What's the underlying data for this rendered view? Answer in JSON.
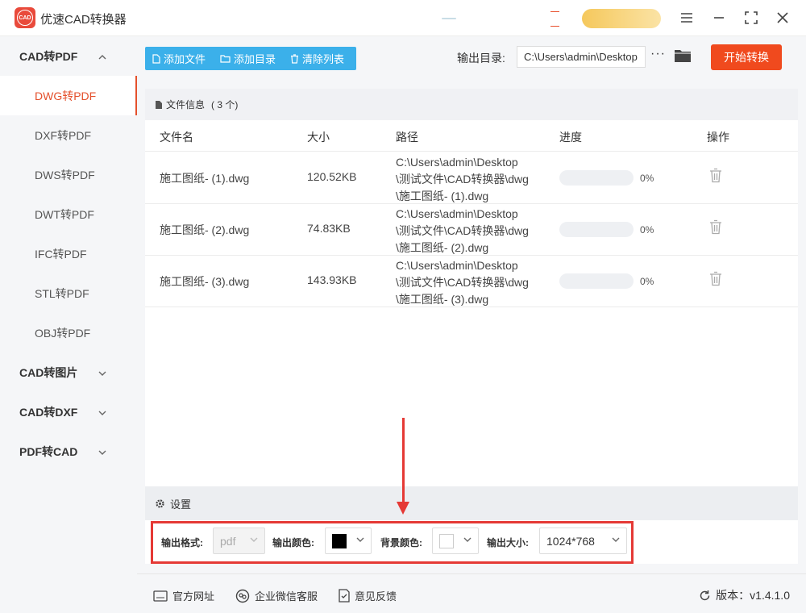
{
  "app": {
    "logo_text": "CAD",
    "title": "优速CAD转换器"
  },
  "window_controls": {
    "menu": "≡",
    "minimize": "—",
    "maximize": "⤢",
    "close": "✕"
  },
  "sidebar": {
    "groups": [
      {
        "label": "CAD转PDF",
        "expanded": true
      },
      {
        "label": "CAD转图片",
        "expanded": false
      },
      {
        "label": "CAD转DXF",
        "expanded": false
      },
      {
        "label": "PDF转CAD",
        "expanded": false
      }
    ],
    "items": [
      {
        "label": "DWG转PDF",
        "active": true
      },
      {
        "label": "DXF转PDF"
      },
      {
        "label": "DWS转PDF"
      },
      {
        "label": "DWT转PDF"
      },
      {
        "label": "IFC转PDF"
      },
      {
        "label": "STL转PDF"
      },
      {
        "label": "OBJ转PDF"
      }
    ]
  },
  "toolbar": {
    "add_file": "添加文件",
    "add_folder": "添加目录",
    "clear_list": "清除列表",
    "output_label": "输出目录:",
    "output_path": "C:\\Users\\admin\\Desktop",
    "more": "···",
    "start": "开始转换"
  },
  "file_info": {
    "title": "文件信息",
    "count": "( 3 个)"
  },
  "table": {
    "headers": {
      "name": "文件名",
      "size": "大小",
      "path": "路径",
      "progress": "进度",
      "action": "操作"
    },
    "rows": [
      {
        "name": "施工图纸- (1).dwg",
        "size": "120.52KB",
        "path1": "C:\\Users\\admin\\Desktop",
        "path2": "\\测试文件\\CAD转换器\\dwg",
        "path3": "\\施工图纸- (1).dwg",
        "progress": 0,
        "pct": "0%"
      },
      {
        "name": "施工图纸- (2).dwg",
        "size": "74.83KB",
        "path1": "C:\\Users\\admin\\Desktop",
        "path2": "\\测试文件\\CAD转换器\\dwg",
        "path3": "\\施工图纸- (2).dwg",
        "progress": 0,
        "pct": "0%"
      },
      {
        "name": "施工图纸- (3).dwg",
        "size": "143.93KB",
        "path1": "C:\\Users\\admin\\Desktop",
        "path2": "\\测试文件\\CAD转换器\\dwg",
        "path3": "\\施工图纸- (3).dwg",
        "progress": 0,
        "pct": "0%"
      }
    ]
  },
  "settings": {
    "title": "设置",
    "format_label": "输出格式:",
    "format_value": "pdf",
    "color_label": "输出颜色:",
    "color_value": "#000000",
    "bg_label": "背景颜色:",
    "bg_value": "#ffffff",
    "size_label": "输出大小:",
    "size_value": "1024*768"
  },
  "footer": {
    "website": "官方网址",
    "wechat": "企业微信客服",
    "feedback": "意见反馈",
    "version": "版本：v1.4.1.0"
  },
  "colors": {
    "accent_orange": "#f04a1e",
    "accent_blue": "#3bb0ea",
    "highlight_red": "#e53935"
  }
}
